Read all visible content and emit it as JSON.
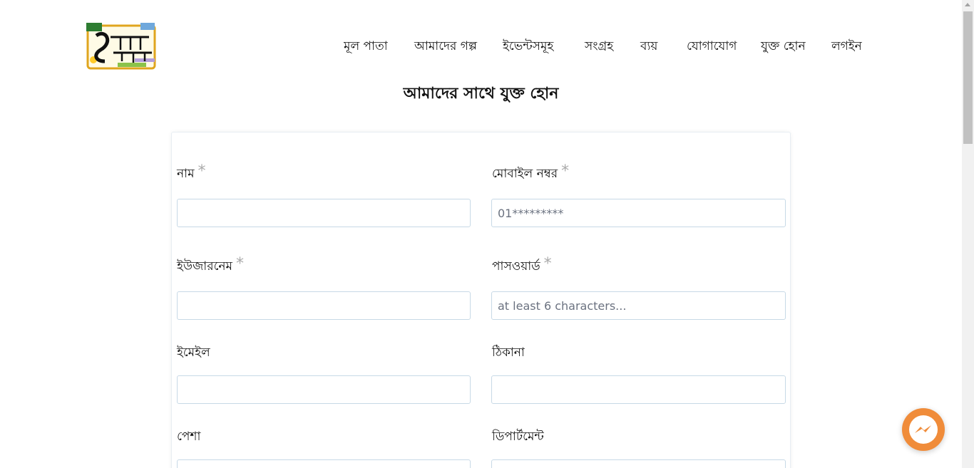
{
  "logo": {
    "icon": "taka-shikkha-logo",
    "text": "১টাকায় শিক্ষা"
  },
  "nav": {
    "items": [
      {
        "label": "মূল পাতা"
      },
      {
        "label": "আমাদের গল্প"
      },
      {
        "label": "ইভেন্টসমূহ"
      },
      {
        "label": "সংগ্রহ"
      },
      {
        "label": "ব্যয়"
      },
      {
        "label": "যোগাযোগ"
      },
      {
        "label": "যুক্ত হোন"
      },
      {
        "label": "লগইন"
      }
    ]
  },
  "page": {
    "title": "আমাদের সাথে যুক্ত হোন"
  },
  "form": {
    "name": {
      "label": "নাম",
      "required": "*",
      "value": "",
      "placeholder": ""
    },
    "mobile": {
      "label": "মোবাইল নম্বর",
      "required": "*",
      "value": "",
      "placeholder": "01*********"
    },
    "username": {
      "label": "ইউজারনেম",
      "required": "*",
      "value": "",
      "placeholder": ""
    },
    "password": {
      "label": "পাসওয়ার্ড",
      "required": "*",
      "value": "",
      "placeholder": "at least 6 characters..."
    },
    "email": {
      "label": "ইমেইল",
      "value": "",
      "placeholder": ""
    },
    "address": {
      "label": "ঠিকানা",
      "value": "",
      "placeholder": ""
    },
    "profession": {
      "label": "পেশা",
      "value": "",
      "placeholder": ""
    },
    "department": {
      "label": "ডিপার্টমেন্ট",
      "value": "",
      "placeholder": ""
    }
  },
  "colors": {
    "accent": "#f08c3a",
    "border": "#c7d9e6",
    "required": "#aaaaaa"
  },
  "messenger": {
    "icon": "messenger-icon"
  }
}
